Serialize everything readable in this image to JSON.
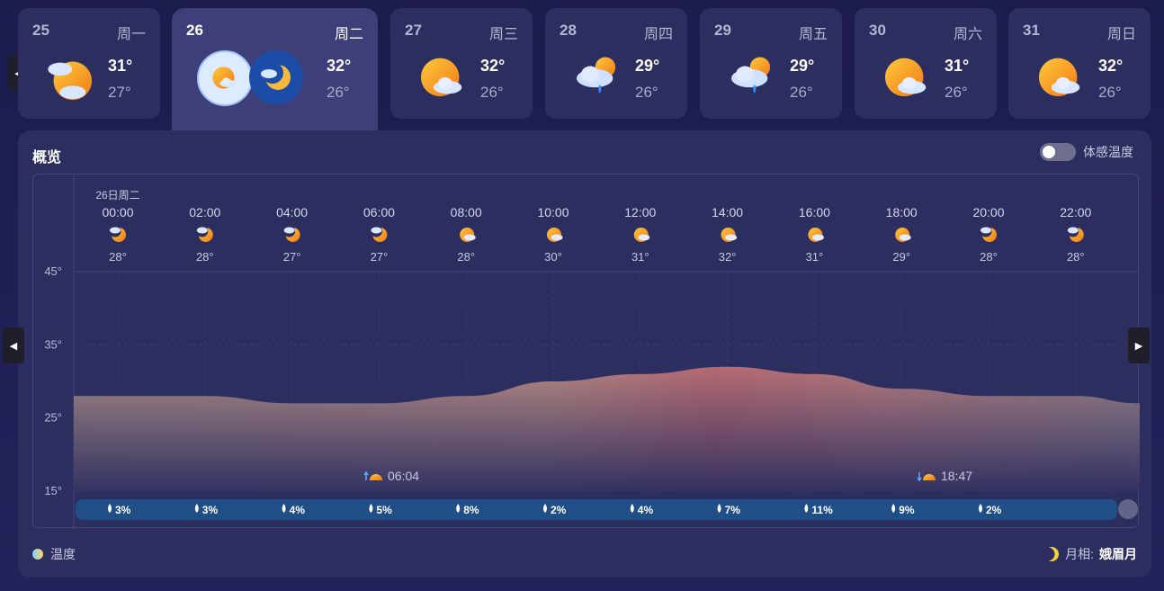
{
  "days": [
    {
      "date": "25",
      "weekday": "周一",
      "high": "31°",
      "low": "27°",
      "icon": "partly-cloudy-night-icon"
    },
    {
      "date": "26",
      "weekday": "周二",
      "high": "32°",
      "low": "26°",
      "icon": "partly-cloudy-icon",
      "selected": true
    },
    {
      "date": "27",
      "weekday": "周三",
      "high": "32°",
      "low": "26°",
      "icon": "partly-cloudy-icon"
    },
    {
      "date": "28",
      "weekday": "周四",
      "high": "29°",
      "low": "26°",
      "icon": "shower-icon"
    },
    {
      "date": "29",
      "weekday": "周五",
      "high": "29°",
      "low": "26°",
      "icon": "shower-icon"
    },
    {
      "date": "30",
      "weekday": "周六",
      "high": "31°",
      "low": "26°",
      "icon": "partly-cloudy-icon"
    },
    {
      "date": "31",
      "weekday": "周日",
      "high": "32°",
      "low": "26°",
      "icon": "partly-cloudy-icon"
    }
  ],
  "overview": {
    "title": "概览",
    "feels_like_label": "体感温度",
    "feels_like_on": false,
    "date_label": "26日周二",
    "legend_label": "温度",
    "moon_phase_label": "月相:",
    "moon_phase_value": "娥眉月",
    "sunrise": "06:04",
    "sunset": "18:47"
  },
  "chart_data": {
    "type": "area",
    "x": [
      "00:00",
      "02:00",
      "04:00",
      "06:00",
      "08:00",
      "10:00",
      "12:00",
      "14:00",
      "16:00",
      "18:00",
      "20:00",
      "22:00"
    ],
    "temperatures": [
      28,
      28,
      27,
      27,
      28,
      30,
      31,
      32,
      31,
      29,
      28,
      28
    ],
    "temperature_labels": [
      "28°",
      "28°",
      "27°",
      "27°",
      "28°",
      "30°",
      "31°",
      "32°",
      "31°",
      "29°",
      "28°",
      "28°"
    ],
    "precipitation": [
      "3%",
      "3%",
      "4%",
      "5%",
      "8%",
      "2%",
      "4%",
      "7%",
      "11%",
      "9%",
      "2%"
    ],
    "y_ticks": [
      "45°",
      "35°",
      "25°",
      "15°"
    ],
    "ylim": [
      15,
      45
    ],
    "icons": [
      "partly-cloudy-night-icon",
      "partly-cloudy-night-icon",
      "partly-cloudy-night-icon",
      "partly-cloudy-night-icon",
      "partly-cloudy-icon",
      "partly-cloudy-icon",
      "partly-cloudy-icon",
      "partly-cloudy-icon",
      "partly-cloudy-icon",
      "partly-cloudy-icon",
      "partly-cloudy-night-icon",
      "partly-cloudy-night-icon"
    ]
  }
}
